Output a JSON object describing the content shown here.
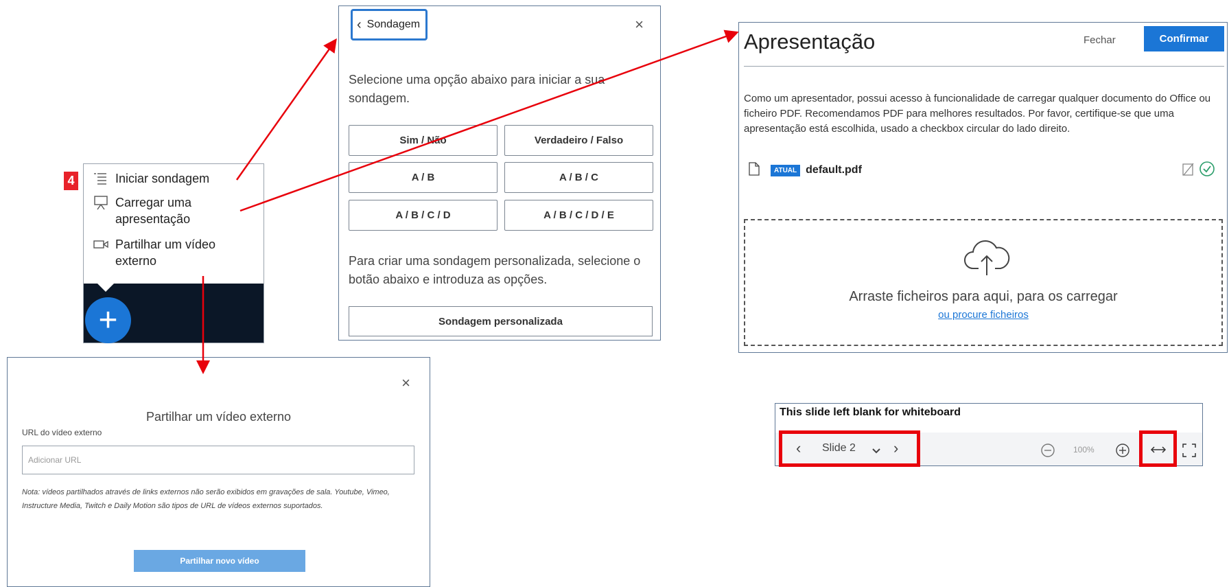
{
  "step_badge": "4",
  "action_menu": {
    "items": [
      {
        "label": "Iniciar sondagem",
        "icon": "list-icon"
      },
      {
        "label_line1": "Carregar uma",
        "label_line2": "apresentação",
        "icon": "presentation-icon"
      },
      {
        "label_line1": "Partilhar um vídeo",
        "label_line2": "externo",
        "icon": "video-icon"
      }
    ],
    "fab_label": "+"
  },
  "poll": {
    "back_label": "Sondagem",
    "close_label": "×",
    "intro": "Selecione uma opção abaixo para iniciar a sua sondagem.",
    "options": [
      "Sim / Não",
      "Verdadeiro / Falso",
      "A / B",
      "A / B / C",
      "A / B / C / D",
      "A / B / C / D / E"
    ],
    "custom_text": "Para criar uma sondagem personalizada, selecione o botão abaixo e introduza as opções.",
    "custom_button": "Sondagem personalizada"
  },
  "presentation": {
    "title": "Apresentação",
    "close_label": "Fechar",
    "confirm_label": "Confirmar",
    "description": "Como um apresentador, possui acesso à funcionalidade de carregar qualquer documento do Office ou ficheiro PDF. Recomendamos PDF para melhores resultados. Por favor, certifique-se que uma apresentação está escolhida, usado a checkbox circular do lado direito.",
    "file": {
      "badge": "ATUAL",
      "name": "default.pdf"
    },
    "drop_text": "Arraste ficheiros para aqui, para os carregar",
    "drop_link": "ou procure ficheiros"
  },
  "slide_toolbar": {
    "title": "This slide left blank for whiteboard",
    "slide_label": "Slide 2",
    "zoom": "100%"
  },
  "video_modal": {
    "title": "Partilhar um vídeo externo",
    "url_label": "URL do vídeo externo",
    "url_placeholder": "Adicionar URL",
    "note": "Nota: vídeos partilhados através de links externos não serão exibidos em gravações de sala. Youtube, Vimeo, Instructure Media, Twitch e Daily Motion são tipos de URL de vídeos externos suportados.",
    "share_button": "Partilhar novo vídeo",
    "close_label": "×"
  },
  "colors": {
    "accent": "#1b76d6",
    "arrow": "#e8000b",
    "dark": "#0b1727"
  }
}
